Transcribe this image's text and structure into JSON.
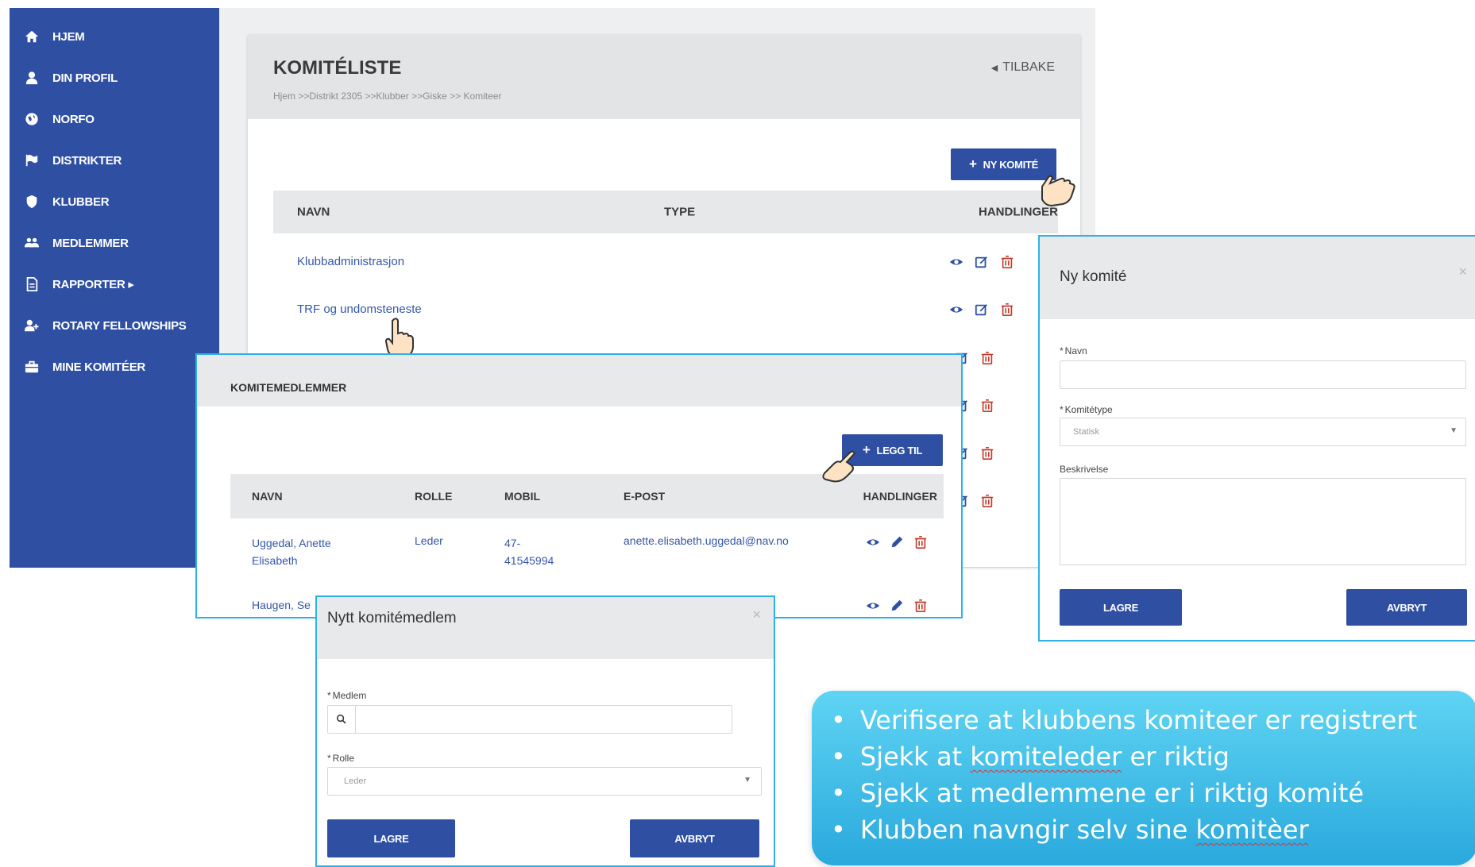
{
  "sidebar": {
    "items": [
      {
        "label": "HJEM",
        "icon": "home-icon"
      },
      {
        "label": "DIN PROFIL",
        "icon": "user-icon"
      },
      {
        "label": "NORFO",
        "icon": "globe-icon"
      },
      {
        "label": "DISTRIKTER",
        "icon": "flag-icon"
      },
      {
        "label": "KLUBBER",
        "icon": "shield-icon"
      },
      {
        "label": "MEDLEMMER",
        "icon": "users-icon"
      },
      {
        "label": "RAPPORTER ▸",
        "icon": "report-icon"
      },
      {
        "label": "ROTARY FELLOWSHIPS",
        "icon": "user-plus-icon"
      },
      {
        "label": "MINE KOMITÉER",
        "icon": "briefcase-icon"
      }
    ]
  },
  "main": {
    "title": "KOMITÉLISTE",
    "breadcrumb": "Hjem >>Distrikt 2305 >>Klubber >>Giske >> Komiteer",
    "back_label": "TILBAKE",
    "new_button": "NY KOMITÉ",
    "columns": [
      "NAVN",
      "TYPE",
      "HANDLINGER"
    ],
    "rows": [
      {
        "name": "Klubbadministrasjon"
      },
      {
        "name": "TRF og undomsteneste"
      }
    ]
  },
  "members_panel": {
    "title": "KOMITEMEDLEMMER",
    "add_button": "LEGG TIL",
    "columns": [
      "NAVN",
      "ROLLE",
      "MOBIL",
      "E-POST",
      "HANDLINGER"
    ],
    "rows": [
      {
        "name_line1": "Uggedal, Anette",
        "name_line2": "Elisabeth",
        "role": "Leder",
        "mobile_line1": "47-",
        "mobile_line2": "41545994",
        "email": "anette.elisabeth.uggedal@nav.no"
      },
      {
        "name_line1": "Haugen, Se"
      }
    ]
  },
  "new_committee_modal": {
    "title": "Ny komité",
    "close": "×",
    "name_label": "Navn",
    "type_label": "Komitétype",
    "type_value": "Statisk",
    "description_label": "Beskrivelse",
    "save": "LAGRE",
    "cancel": "AVBRYT"
  },
  "new_member_modal": {
    "title": "Nytt komitémedlem",
    "close": "×",
    "member_label": "Medlem",
    "role_label": "Rolle",
    "role_value": "Leder",
    "save": "LAGRE",
    "cancel": "AVBRYT"
  },
  "info_box": {
    "bullet1": "Verifisere at klubbens komiteer er registrert",
    "bullet2_pre": "Sjekk at ",
    "bullet2_mark": "komiteleder",
    "bullet2_post": " er riktig",
    "bullet3": "Sjekk at medlemmene er i riktig komité",
    "bullet4_pre": "Klubben navngir selv sine ",
    "bullet4_mark": "komitèer"
  },
  "colors": {
    "sidebar": "#2f4fa3",
    "primary_button": "#2f4fa3",
    "modal_border": "#2eb2e6",
    "info_box": "#39b6e6",
    "delete_icon": "#c0392b"
  }
}
